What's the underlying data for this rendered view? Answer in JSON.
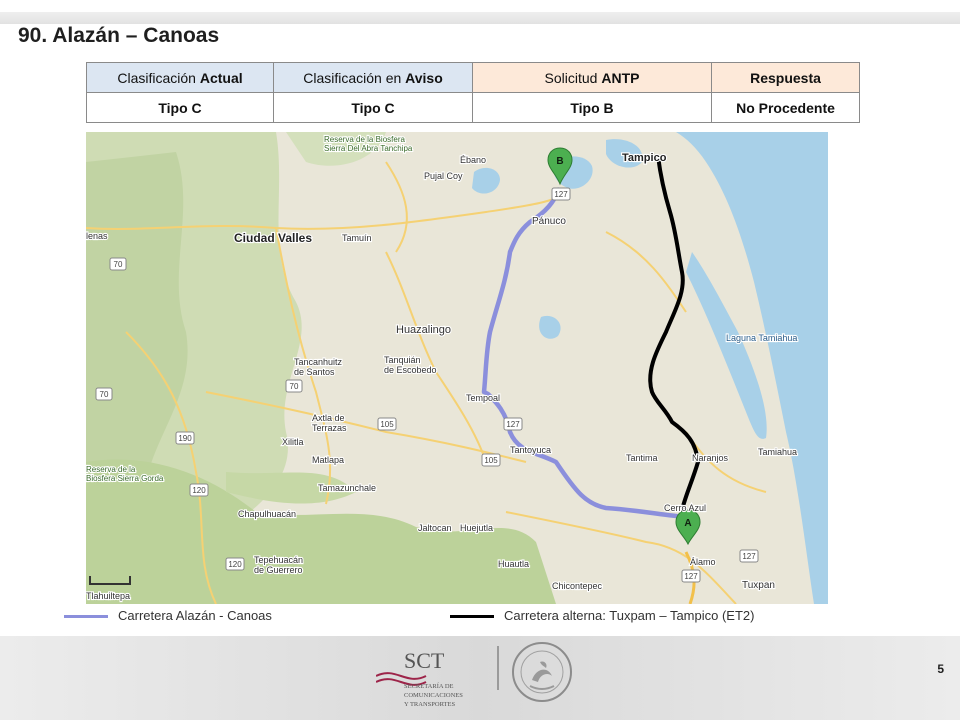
{
  "title": "90. Alazán – Canoas",
  "table": {
    "header": [
      {
        "prefix": "Clasificación ",
        "bold": "Actual"
      },
      {
        "prefix": "Clasificación en ",
        "bold": "Aviso"
      },
      {
        "prefix": "Solicitud ",
        "bold": "ANTP"
      },
      {
        "prefix": "",
        "bold": "Respuesta"
      }
    ],
    "values": [
      "Tipo C",
      "Tipo C",
      "Tipo B",
      "No Procedente"
    ]
  },
  "map": {
    "places": [
      {
        "id": "biosfera-tanchipa",
        "text": "Reserva de la Biosfera\nSierra Del Abra Tanchipa"
      },
      {
        "id": "ebano",
        "text": "Ébano"
      },
      {
        "id": "tampico",
        "text": "Tampico"
      },
      {
        "id": "pujal-coy",
        "text": "Pujal Coy"
      },
      {
        "id": "panuco",
        "text": "Pánuco"
      },
      {
        "id": "ciudad-valles",
        "text": "Ciudad Valles"
      },
      {
        "id": "tamuin",
        "text": "Tamuín"
      },
      {
        "id": "lenas",
        "text": "lenas"
      },
      {
        "id": "huazalingo",
        "text": "Huazalingo"
      },
      {
        "id": "laguna-tamiahua",
        "text": "Laguna Tamiahua"
      },
      {
        "id": "tancanhuitz",
        "text": "Tancanhuitz\nde Santos"
      },
      {
        "id": "tanquian",
        "text": "Tanquián\nde Escobedo"
      },
      {
        "id": "tempoal",
        "text": "Tempoal"
      },
      {
        "id": "axtla",
        "text": "Axtla de\nTerrazas"
      },
      {
        "id": "xilitla",
        "text": "Xilitla"
      },
      {
        "id": "tantoyuca",
        "text": "Tantoyuca"
      },
      {
        "id": "tantima",
        "text": "Tantima"
      },
      {
        "id": "naranjos",
        "text": "Naranjos"
      },
      {
        "id": "tamiahua",
        "text": "Tamiahua"
      },
      {
        "id": "matlapa",
        "text": "Matlapa"
      },
      {
        "id": "biosfera-gorda",
        "text": "Reserva de la\nBiosfera Sierra Gorda"
      },
      {
        "id": "tamazunchale",
        "text": "Tamazunchale"
      },
      {
        "id": "cerro-azul",
        "text": "Cerro Azul"
      },
      {
        "id": "chapulhuacan",
        "text": "Chapulhuacán"
      },
      {
        "id": "jaltocan",
        "text": "Jaltocan"
      },
      {
        "id": "huejutla",
        "text": "Huejutla"
      },
      {
        "id": "huautla",
        "text": "Huautla"
      },
      {
        "id": "chicontepec",
        "text": "Chicontepec"
      },
      {
        "id": "alamo",
        "text": "Álamo"
      },
      {
        "id": "tuxpan",
        "text": "Tuxpan"
      },
      {
        "id": "tlahuiltepa",
        "text": "Tlahuiltepa"
      },
      {
        "id": "tepehuacan",
        "text": "Tepehuacán\nde Guerrero"
      }
    ],
    "route_shields": [
      "127",
      "127",
      "105",
      "70",
      "70",
      "70",
      "190",
      "120",
      "120",
      "105",
      "127",
      "127"
    ],
    "markers": [
      "A",
      "B"
    ]
  },
  "legend": {
    "alazan": {
      "label": "Carretera Alazán - Canoas",
      "color": "#8b8fdc"
    },
    "alterna": {
      "label": "Carretera alterna: Tuxpam – Tampico (ET2)",
      "color": "#000000"
    }
  },
  "footer": {
    "page_number": "5",
    "logo_title": "SCT",
    "logo_sub": [
      "SECRETARÍA DE",
      "COMUNICACIONES",
      "Y TRANSPORTES"
    ],
    "seal_text": "ESTADOS UNIDOS MEXICANOS"
  }
}
